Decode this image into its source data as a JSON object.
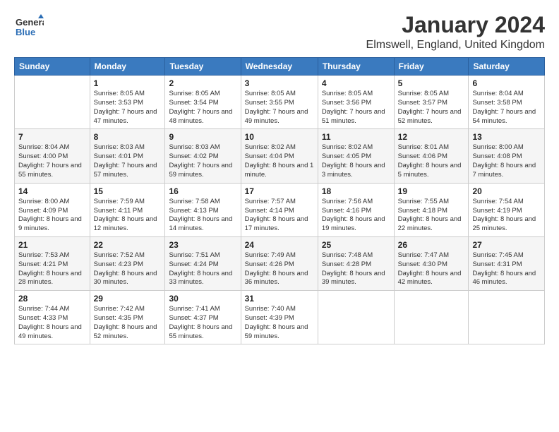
{
  "logo": {
    "general": "General",
    "blue": "Blue"
  },
  "title": "January 2024",
  "subtitle": "Elmswell, England, United Kingdom",
  "days_header": [
    "Sunday",
    "Monday",
    "Tuesday",
    "Wednesday",
    "Thursday",
    "Friday",
    "Saturday"
  ],
  "weeks": [
    [
      {
        "day": "",
        "sunrise": "",
        "sunset": "",
        "daylight": ""
      },
      {
        "day": "1",
        "sunrise": "Sunrise: 8:05 AM",
        "sunset": "Sunset: 3:53 PM",
        "daylight": "Daylight: 7 hours and 47 minutes."
      },
      {
        "day": "2",
        "sunrise": "Sunrise: 8:05 AM",
        "sunset": "Sunset: 3:54 PM",
        "daylight": "Daylight: 7 hours and 48 minutes."
      },
      {
        "day": "3",
        "sunrise": "Sunrise: 8:05 AM",
        "sunset": "Sunset: 3:55 PM",
        "daylight": "Daylight: 7 hours and 49 minutes."
      },
      {
        "day": "4",
        "sunrise": "Sunrise: 8:05 AM",
        "sunset": "Sunset: 3:56 PM",
        "daylight": "Daylight: 7 hours and 51 minutes."
      },
      {
        "day": "5",
        "sunrise": "Sunrise: 8:05 AM",
        "sunset": "Sunset: 3:57 PM",
        "daylight": "Daylight: 7 hours and 52 minutes."
      },
      {
        "day": "6",
        "sunrise": "Sunrise: 8:04 AM",
        "sunset": "Sunset: 3:58 PM",
        "daylight": "Daylight: 7 hours and 54 minutes."
      }
    ],
    [
      {
        "day": "7",
        "sunrise": "Sunrise: 8:04 AM",
        "sunset": "Sunset: 4:00 PM",
        "daylight": "Daylight: 7 hours and 55 minutes."
      },
      {
        "day": "8",
        "sunrise": "Sunrise: 8:03 AM",
        "sunset": "Sunset: 4:01 PM",
        "daylight": "Daylight: 7 hours and 57 minutes."
      },
      {
        "day": "9",
        "sunrise": "Sunrise: 8:03 AM",
        "sunset": "Sunset: 4:02 PM",
        "daylight": "Daylight: 7 hours and 59 minutes."
      },
      {
        "day": "10",
        "sunrise": "Sunrise: 8:02 AM",
        "sunset": "Sunset: 4:04 PM",
        "daylight": "Daylight: 8 hours and 1 minute."
      },
      {
        "day": "11",
        "sunrise": "Sunrise: 8:02 AM",
        "sunset": "Sunset: 4:05 PM",
        "daylight": "Daylight: 8 hours and 3 minutes."
      },
      {
        "day": "12",
        "sunrise": "Sunrise: 8:01 AM",
        "sunset": "Sunset: 4:06 PM",
        "daylight": "Daylight: 8 hours and 5 minutes."
      },
      {
        "day": "13",
        "sunrise": "Sunrise: 8:00 AM",
        "sunset": "Sunset: 4:08 PM",
        "daylight": "Daylight: 8 hours and 7 minutes."
      }
    ],
    [
      {
        "day": "14",
        "sunrise": "Sunrise: 8:00 AM",
        "sunset": "Sunset: 4:09 PM",
        "daylight": "Daylight: 8 hours and 9 minutes."
      },
      {
        "day": "15",
        "sunrise": "Sunrise: 7:59 AM",
        "sunset": "Sunset: 4:11 PM",
        "daylight": "Daylight: 8 hours and 12 minutes."
      },
      {
        "day": "16",
        "sunrise": "Sunrise: 7:58 AM",
        "sunset": "Sunset: 4:13 PM",
        "daylight": "Daylight: 8 hours and 14 minutes."
      },
      {
        "day": "17",
        "sunrise": "Sunrise: 7:57 AM",
        "sunset": "Sunset: 4:14 PM",
        "daylight": "Daylight: 8 hours and 17 minutes."
      },
      {
        "day": "18",
        "sunrise": "Sunrise: 7:56 AM",
        "sunset": "Sunset: 4:16 PM",
        "daylight": "Daylight: 8 hours and 19 minutes."
      },
      {
        "day": "19",
        "sunrise": "Sunrise: 7:55 AM",
        "sunset": "Sunset: 4:18 PM",
        "daylight": "Daylight: 8 hours and 22 minutes."
      },
      {
        "day": "20",
        "sunrise": "Sunrise: 7:54 AM",
        "sunset": "Sunset: 4:19 PM",
        "daylight": "Daylight: 8 hours and 25 minutes."
      }
    ],
    [
      {
        "day": "21",
        "sunrise": "Sunrise: 7:53 AM",
        "sunset": "Sunset: 4:21 PM",
        "daylight": "Daylight: 8 hours and 28 minutes."
      },
      {
        "day": "22",
        "sunrise": "Sunrise: 7:52 AM",
        "sunset": "Sunset: 4:23 PM",
        "daylight": "Daylight: 8 hours and 30 minutes."
      },
      {
        "day": "23",
        "sunrise": "Sunrise: 7:51 AM",
        "sunset": "Sunset: 4:24 PM",
        "daylight": "Daylight: 8 hours and 33 minutes."
      },
      {
        "day": "24",
        "sunrise": "Sunrise: 7:49 AM",
        "sunset": "Sunset: 4:26 PM",
        "daylight": "Daylight: 8 hours and 36 minutes."
      },
      {
        "day": "25",
        "sunrise": "Sunrise: 7:48 AM",
        "sunset": "Sunset: 4:28 PM",
        "daylight": "Daylight: 8 hours and 39 minutes."
      },
      {
        "day": "26",
        "sunrise": "Sunrise: 7:47 AM",
        "sunset": "Sunset: 4:30 PM",
        "daylight": "Daylight: 8 hours and 42 minutes."
      },
      {
        "day": "27",
        "sunrise": "Sunrise: 7:45 AM",
        "sunset": "Sunset: 4:31 PM",
        "daylight": "Daylight: 8 hours and 46 minutes."
      }
    ],
    [
      {
        "day": "28",
        "sunrise": "Sunrise: 7:44 AM",
        "sunset": "Sunset: 4:33 PM",
        "daylight": "Daylight: 8 hours and 49 minutes."
      },
      {
        "day": "29",
        "sunrise": "Sunrise: 7:42 AM",
        "sunset": "Sunset: 4:35 PM",
        "daylight": "Daylight: 8 hours and 52 minutes."
      },
      {
        "day": "30",
        "sunrise": "Sunrise: 7:41 AM",
        "sunset": "Sunset: 4:37 PM",
        "daylight": "Daylight: 8 hours and 55 minutes."
      },
      {
        "day": "31",
        "sunrise": "Sunrise: 7:40 AM",
        "sunset": "Sunset: 4:39 PM",
        "daylight": "Daylight: 8 hours and 59 minutes."
      },
      {
        "day": "",
        "sunrise": "",
        "sunset": "",
        "daylight": ""
      },
      {
        "day": "",
        "sunrise": "",
        "sunset": "",
        "daylight": ""
      },
      {
        "day": "",
        "sunrise": "",
        "sunset": "",
        "daylight": ""
      }
    ]
  ]
}
